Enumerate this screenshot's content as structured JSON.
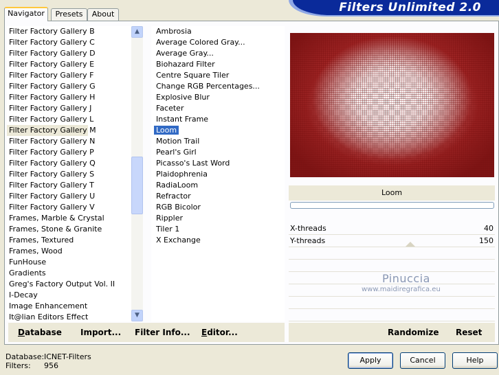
{
  "banner": {
    "title": "Filters Unlimited 2.0"
  },
  "tabs": [
    {
      "label": "Navigator"
    },
    {
      "label": "Presets"
    },
    {
      "label": "About"
    }
  ],
  "categories": {
    "selected": "Filter Factory Gallery M",
    "items": [
      "Filter Factory Gallery B",
      "Filter Factory Gallery C",
      "Filter Factory Gallery D",
      "Filter Factory Gallery E",
      "Filter Factory Gallery F",
      "Filter Factory Gallery G",
      "Filter Factory Gallery H",
      "Filter Factory Gallery J",
      "Filter Factory Gallery L",
      "Filter Factory Gallery M",
      "Filter Factory Gallery N",
      "Filter Factory Gallery P",
      "Filter Factory Gallery Q",
      "Filter Factory Gallery S",
      "Filter Factory Gallery T",
      "Filter Factory Gallery U",
      "Filter Factory Gallery V",
      "Frames, Marble & Crystal",
      "Frames, Stone & Granite",
      "Frames, Textured",
      "Frames, Wood",
      "FunHouse",
      "Gradients",
      "Greg's Factory Output Vol. II",
      "I-Decay",
      "Image Enhancement",
      "It@lian Editors Effect"
    ]
  },
  "filters": {
    "selected": "Loom",
    "items": [
      "Ambrosia",
      "Average Colored Gray...",
      "Average Gray...",
      "Biohazard Filter",
      "Centre Square Tiler",
      "Change RGB Percentages...",
      "Explosive Blur",
      "Faceter",
      "Instant Frame",
      "Loom",
      "Motion Trail",
      "Pearl's Girl",
      "Picasso's Last Word",
      "Plaidophrenia",
      "RadiaLoom",
      "Refractor",
      "RGB Bicolor",
      "Rippler",
      "Tiler 1",
      "X Exchange"
    ]
  },
  "filter_name": "Loom",
  "params": [
    {
      "label": "X-threads",
      "value": "40"
    },
    {
      "label": "Y-threads",
      "value": "150"
    }
  ],
  "watermark": {
    "name": "Pinuccia",
    "url": "www.maidiregrafica.eu"
  },
  "left_buttons": {
    "database": {
      "u": "D",
      "rest": "atabase"
    },
    "import": {
      "pre": "Import",
      "u": "",
      "rest": "..."
    },
    "filter_info": {
      "label": "Filter Info..."
    },
    "editor": {
      "u": "E",
      "rest": "ditor..."
    }
  },
  "right_buttons": {
    "randomize": "Randomize",
    "reset": "Reset"
  },
  "status": {
    "database_key": "Database:",
    "database_value": "ICNET-Filters",
    "filters_key": "Filters:",
    "filters_value": "956"
  },
  "dialog_buttons": {
    "apply": "Apply",
    "cancel": "Cancel",
    "help": "Help"
  },
  "colors": {
    "selection": "#316ac5",
    "banner": "#0a2a9a",
    "face": "#ece9d8"
  }
}
